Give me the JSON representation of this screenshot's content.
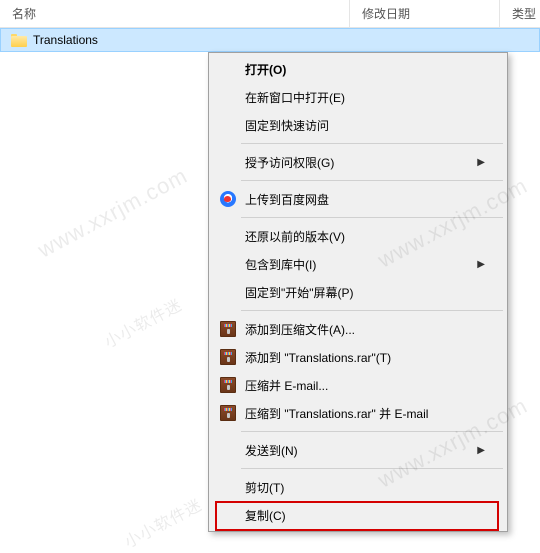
{
  "columns": {
    "name": "名称",
    "date": "修改日期",
    "type": "类型"
  },
  "row": {
    "name": "Translations",
    "date": ""
  },
  "menu": {
    "open": "打开(O)",
    "open_new": "在新窗口中打开(E)",
    "pin_quick": "固定到快速访问",
    "grant_access": "授予访问权限(G)",
    "baidu": "上传到百度网盘",
    "restore": "还原以前的版本(V)",
    "include_lib": "包含到库中(I)",
    "pin_start": "固定到\"开始\"屏幕(P)",
    "rar_add": "添加到压缩文件(A)...",
    "rar_add_to": "添加到 \"Translations.rar\"(T)",
    "rar_email": "压缩并 E-mail...",
    "rar_email_to": "压缩到 \"Translations.rar\" 并 E-mail",
    "send_to": "发送到(N)",
    "cut": "剪切(T)",
    "copy": "复制(C)"
  },
  "watermark": "www.xxrjm.com",
  "watermark_small": "小小软件迷"
}
